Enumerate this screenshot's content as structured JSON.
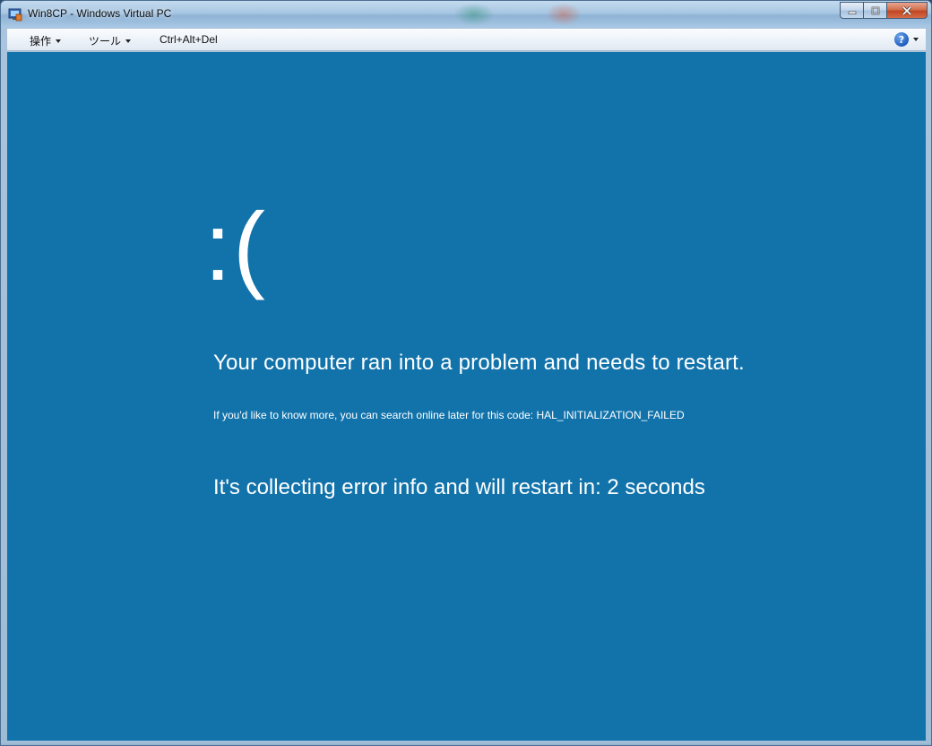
{
  "window": {
    "title": "Win8CP - Windows Virtual PC"
  },
  "toolbar": {
    "actions_label": "操作",
    "tools_label": "ツール",
    "cad_label": "Ctrl+Alt+Del",
    "help_symbol": "?"
  },
  "bsod": {
    "emoticon": ":(",
    "headline": "Your computer ran into a problem and needs to restart.",
    "detail": "If you'd like to know more, you can search online later for this code: HAL_INITIALIZATION_FAILED",
    "countdown": "It's collecting error info and will restart in: 2 seconds"
  },
  "colors": {
    "bsod_background": "#1273ab",
    "text": "#ffffff",
    "close_button": "#c04623"
  },
  "icons": {
    "app": "virtual-pc-icon",
    "minimize": "minimize-icon",
    "maximize": "maximize-icon",
    "close": "close-icon",
    "help": "help-icon"
  }
}
